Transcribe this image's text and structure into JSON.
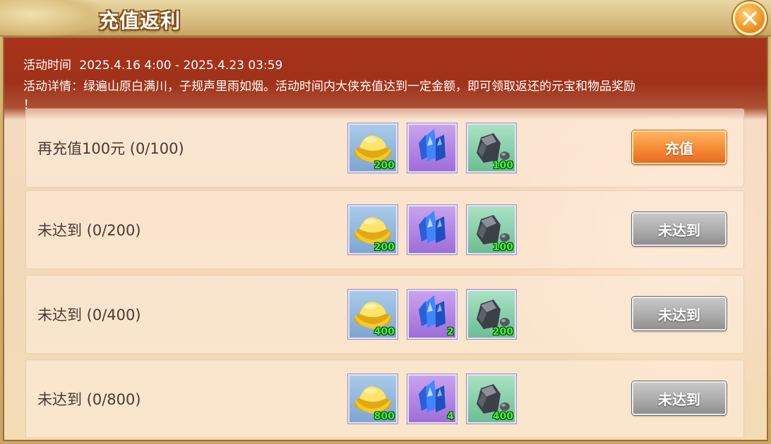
{
  "window": {
    "title": "充值返利",
    "close_icon": "close-icon"
  },
  "info": {
    "time_label": "活动时间",
    "time_value": "2025.4.16 4:00 - 2025.4.23 03:59",
    "detail_line1": "活动详情：绿遍山原白满川，子规声里雨如烟。活动时间内大侠充值达到一定金额，即可领取返还的元宝和物品奖励",
    "detail_line2": "！"
  },
  "tiers": [
    {
      "label": "再充值100元 (0/100)",
      "rewards": [
        {
          "icon": "gold-ingot-icon",
          "count": "200"
        },
        {
          "icon": "blue-crystal-icon",
          "count": ""
        },
        {
          "icon": "dark-ore-icon",
          "count": "100"
        }
      ],
      "button": "充值",
      "state": "active"
    },
    {
      "label": "未达到 (0/200)",
      "rewards": [
        {
          "icon": "gold-ingot-icon",
          "count": "200"
        },
        {
          "icon": "blue-crystal-icon",
          "count": ""
        },
        {
          "icon": "dark-ore-icon",
          "count": "100"
        }
      ],
      "button": "未达到",
      "state": "disabled"
    },
    {
      "label": "未达到 (0/400)",
      "rewards": [
        {
          "icon": "gold-ingot-icon",
          "count": "400"
        },
        {
          "icon": "blue-crystal-icon",
          "count": "2"
        },
        {
          "icon": "dark-ore-icon",
          "count": "200"
        }
      ],
      "button": "未达到",
      "state": "disabled"
    },
    {
      "label": "未达到 (0/800)",
      "rewards": [
        {
          "icon": "gold-ingot-icon",
          "count": "800"
        },
        {
          "icon": "blue-crystal-icon",
          "count": "4"
        },
        {
          "icon": "dark-ore-icon",
          "count": "400"
        }
      ],
      "button": "未达到",
      "state": "disabled"
    }
  ],
  "colors": {
    "info_band": "#a8321a",
    "active_button": "#f68a35",
    "disabled_button": "#a9a9a9",
    "count_text": "#39ff2c"
  }
}
